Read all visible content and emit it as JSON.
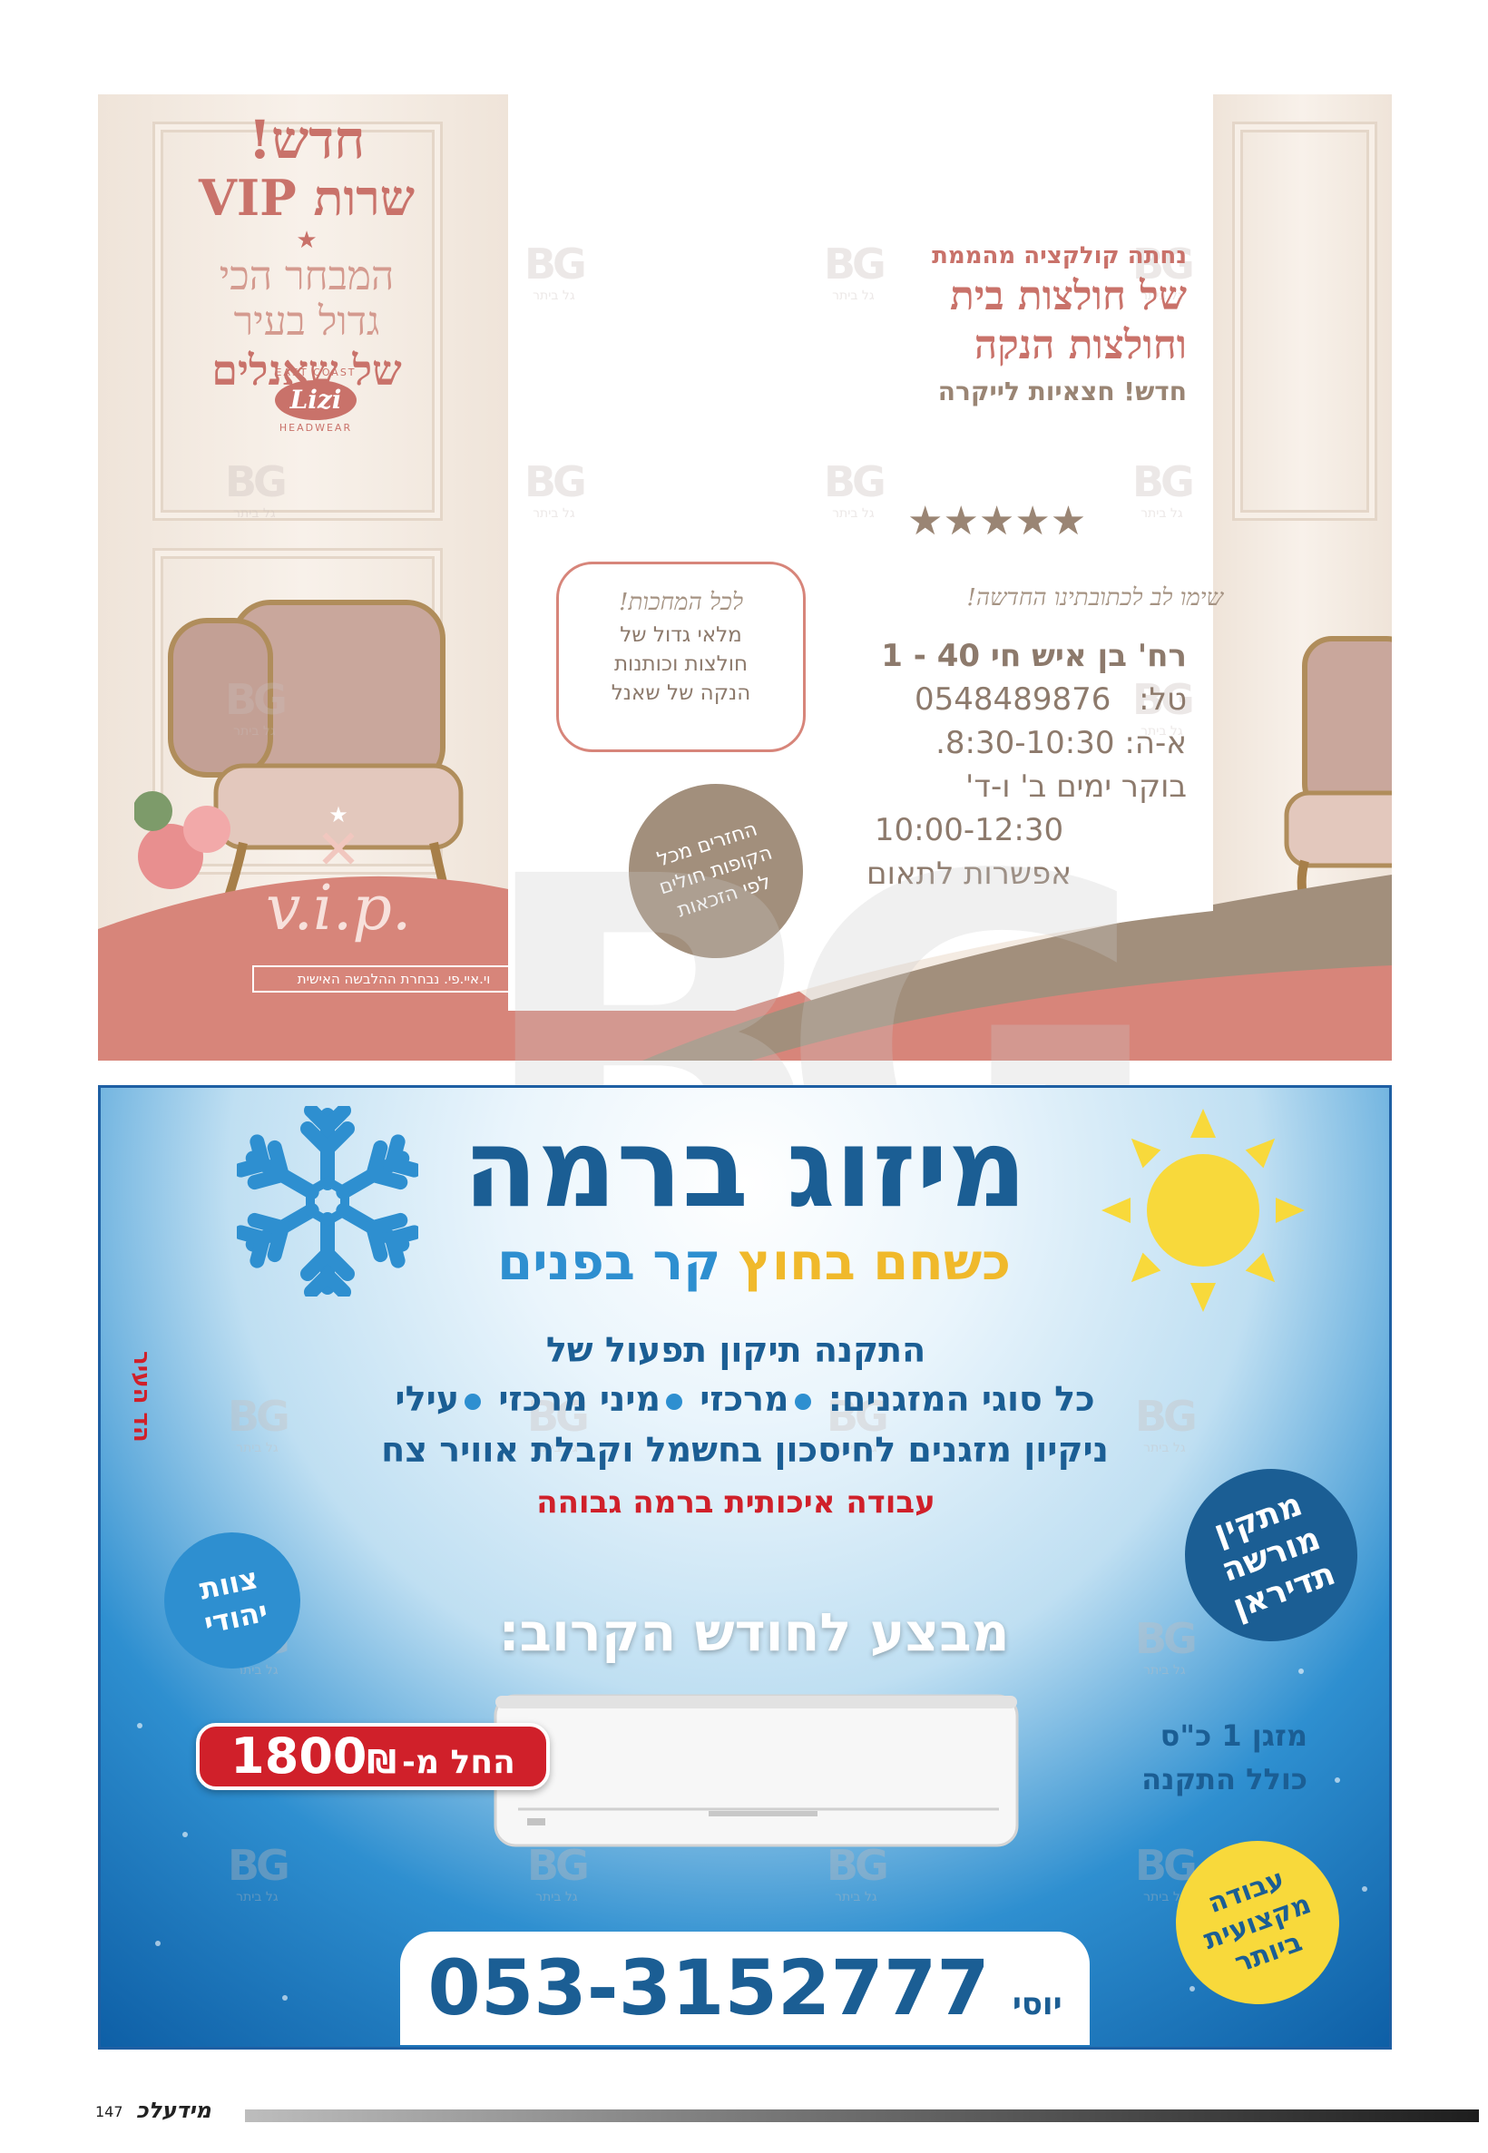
{
  "top_ad": {
    "left": {
      "new_label": "חדש!",
      "vip_service": "שרות VIP",
      "selection_line1": "המבחר הכי",
      "selection_line2": "גדול בעיר",
      "selection_line3": "של שאנלים",
      "lizi_logo": {
        "top_text": "EAST COAST",
        "name": "Lizi",
        "bottom_text": "HEADWEAR"
      },
      "vip_logo_text": "v.i.p.",
      "vip_caption": "וי.איי.פי. נבחרת ההלבשה האישית"
    },
    "right": {
      "line1": "נחתה קולקציה מהממת",
      "line2": "של חולצות בית",
      "line3": "וחולצות הנקה",
      "line4": "חדש! חצאיות לייקרה",
      "stars": "★★★★★",
      "note_heading": "שימו לב לכתובתינו החדשה!",
      "address": "רח' בן איש חי 40 - 1",
      "phone_label": "טל:",
      "phone": "0548489876",
      "hours1": "א-ה: 8:30-10:30.",
      "hours2": "בוקר ימים ב' ו-ד'",
      "hours3": "10:00-12:30",
      "hours4": "אפשרות לתאום"
    },
    "box": {
      "heading": "לכל המחכות!",
      "line1": "מלאי גדול של",
      "line2": "חולצות וכותנות",
      "line3": "הנקה של שאנל"
    },
    "refund_badge": {
      "line1": "החזרים מכל",
      "line2": "הקופות חולים",
      "line3": "לפי הזכאות"
    },
    "watermark": {
      "letters": "BG",
      "sub": "גל ביתר"
    }
  },
  "bottom_ad": {
    "brand": "מיזוג ברמה",
    "slogan_part1": "כשחם בחוץ",
    "slogan_part2": "קר בפנים",
    "services_line1": "התקנה תיקון תפעול של",
    "services_line2_prefix": "כל סוגי המזגנים:",
    "ac_types": [
      "מרכזי",
      "מיני מרכזי",
      "עילי"
    ],
    "services_line3": "ניקיון מזגנים לחיסכון בחשמל וקבלת אוויר צח",
    "services_line4": "עבודה איכותית ברמה גבוהה",
    "side_vertical": "הד העיר",
    "badge_authorized": "מתקין מורשה תדיראן",
    "badge_jewish": "צוות יהודי",
    "badge_professional": "עבודה מקצועית ביותר",
    "offer_title": "מבצע לחודש הקרוב:",
    "offer_item_line1": "מזגן 1 כ\"ס",
    "offer_item_line2": "כולל התקנה",
    "price_prefix": "החל מ-",
    "price_value": "1800",
    "currency": "₪",
    "contact_name": "יוסי",
    "contact_phone": "053-3152777"
  },
  "footer": {
    "page_number": "147",
    "logo": "מידעלכ"
  },
  "colors": {
    "salmon": "#d7857a",
    "taupe": "#a28f7c",
    "navy": "#1b5e94",
    "sky": "#2e8fd0",
    "yellow": "#f8d93b",
    "red": "#d0202a"
  }
}
